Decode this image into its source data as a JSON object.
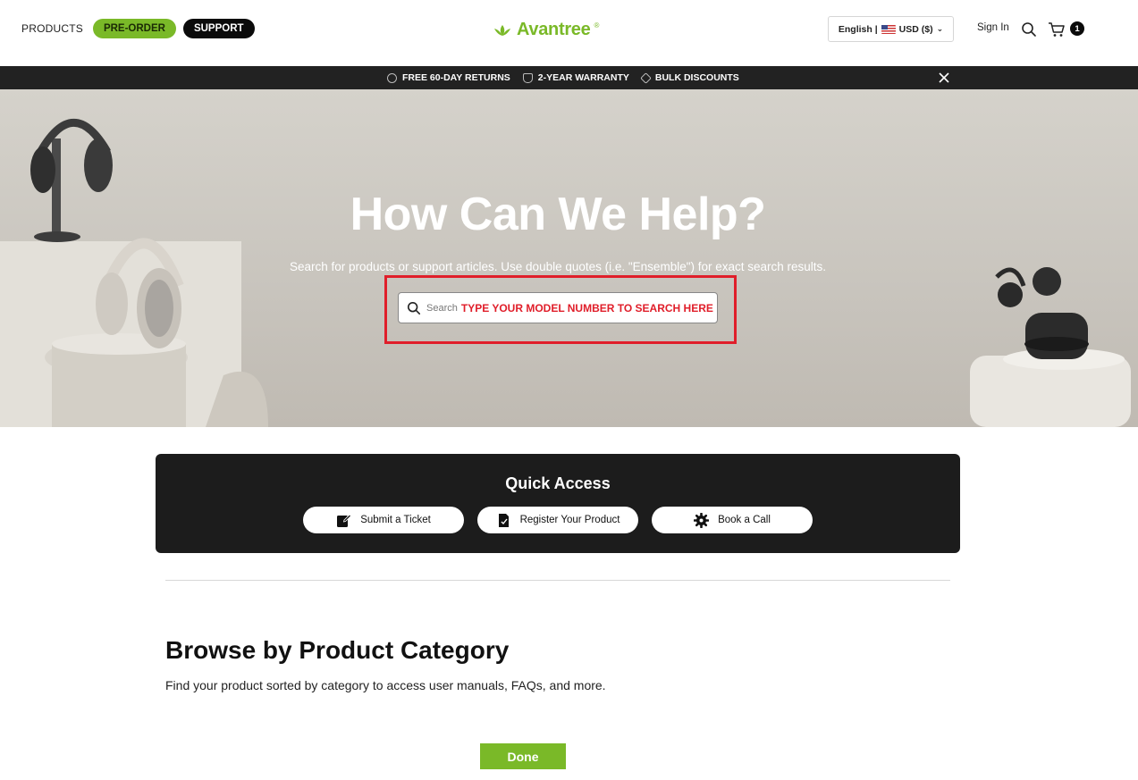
{
  "header": {
    "nav": {
      "products": "PRODUCTS",
      "preorder": "PRE-ORDER",
      "support": "SUPPORT"
    },
    "logo": {
      "text": "Avantree",
      "reg": "®"
    },
    "locale": {
      "language": "English |",
      "currency": "USD ($)"
    },
    "signin": "Sign In",
    "cart_count": "1",
    "colors": {
      "brand_green": "#7ab928",
      "dark": "#0b0b0b"
    }
  },
  "announcement": {
    "items": [
      "FREE 60-DAY RETURNS",
      "2-YEAR WARRANTY",
      "BULK DISCOUNTS"
    ]
  },
  "hero": {
    "title": "How Can We Help?",
    "subtitle": "Search for products or support articles. Use double quotes (i.e. \"Ensemble\") for exact search results.",
    "search_placeholder": "Search",
    "search_hint": "TYPE YOUR MODEL NUMBER TO SEARCH HERE",
    "highlight_color": "#e01e2a"
  },
  "quick_access": {
    "title": "Quick Access",
    "buttons": [
      {
        "label": "Submit a Ticket",
        "icon": "edit-icon"
      },
      {
        "label": "Register Your Product",
        "icon": "document-check-icon"
      },
      {
        "label": "Book a Call",
        "icon": "gear-icon"
      }
    ]
  },
  "browse": {
    "title": "Browse by Product Category",
    "subtitle": "Find your product sorted by category to access user manuals, FAQs, and more."
  },
  "done_button": "Done"
}
